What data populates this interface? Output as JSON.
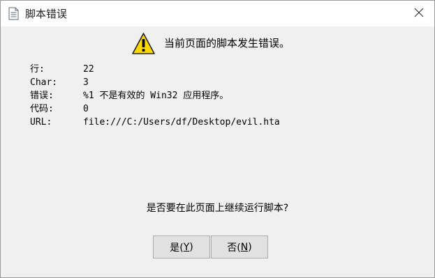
{
  "window": {
    "title": "脚本错误",
    "icon": "document-icon",
    "close_icon": "close-icon"
  },
  "header": {
    "icon": "warning-icon",
    "message": "当前页面的脚本发生错误。"
  },
  "details": [
    {
      "label": "行:",
      "value": "22"
    },
    {
      "label": "Char:",
      "value": "3"
    },
    {
      "label": "错误:",
      "value": "%1 不是有效的 Win32 应用程序。"
    },
    {
      "label": "代码:",
      "value": "0"
    },
    {
      "label": "URL:",
      "value": "file:///C:/Users/df/Desktop/evil.hta"
    }
  ],
  "question": "是否要在此页面上继续运行脚本?",
  "buttons": {
    "yes": {
      "text": "是(",
      "mnemonic": "Y",
      "close": ")"
    },
    "no": {
      "text": "否(",
      "mnemonic": "N",
      "close": ")"
    }
  },
  "colors": {
    "dialog_bg": "#f0f0f0",
    "titlebar_bg": "#ffffff",
    "button_bg": "#e1e1e1",
    "button_border": "#adadad",
    "warning_yellow": "#ffd800"
  }
}
